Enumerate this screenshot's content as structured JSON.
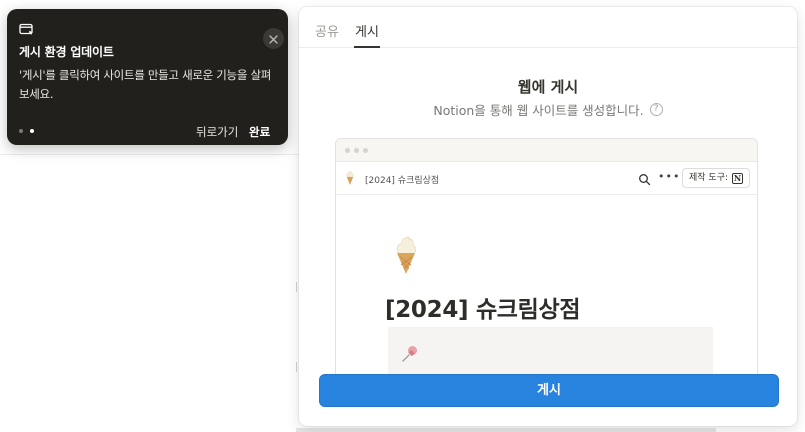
{
  "tooltip": {
    "title": "게시 환경 업데이트",
    "body": "'게시'를 클릭하여 사이트를 만들고 새로운 기능을 살펴보세요.",
    "back_label": "뒤로가기",
    "done_label": "완료",
    "icons": {
      "header": "browser-window-icon",
      "close": "close-icon"
    },
    "colors": {
      "background": "#22201d"
    }
  },
  "modal": {
    "tabs": [
      {
        "label": "공유",
        "active": false
      },
      {
        "label": "게시",
        "active": true
      }
    ],
    "heading": "웹에 게시",
    "subheading": "Notion을 통해 웹 사이트를 생성합니다.",
    "help_icon": "question-circle-icon",
    "preview": {
      "breadcrumb": "[2024] 슈크림상점",
      "made_with_label": "제작 도구:",
      "page_title": "[2024] 슈크림상점",
      "icons": {
        "page": "ice-cream-cone-icon",
        "search": "search-icon",
        "more": "more-horizontal-icon",
        "notion": "notion-logo-icon",
        "pin": "pushpin-icon"
      }
    },
    "publish_button_label": "게시",
    "colors": {
      "accent": "#2783de"
    }
  }
}
